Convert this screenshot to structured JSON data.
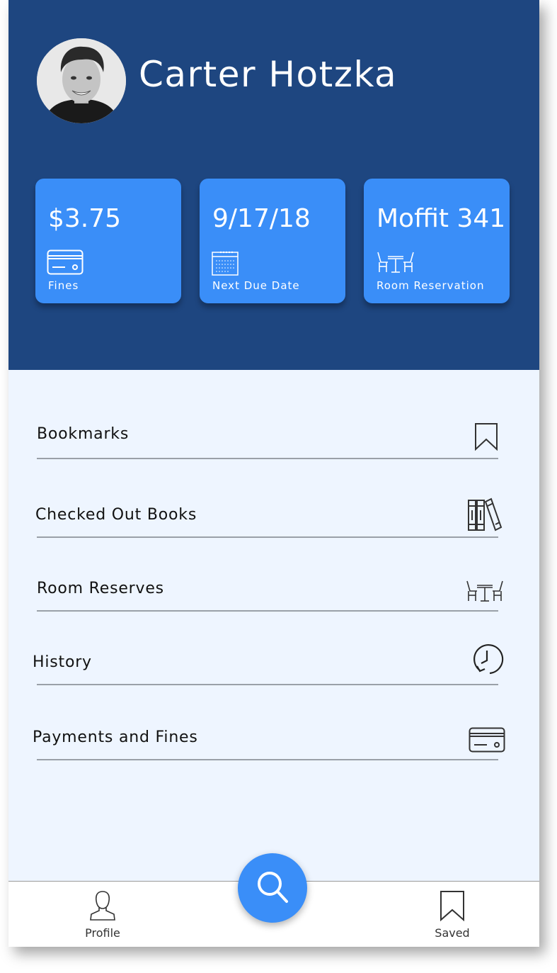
{
  "user": {
    "name": "Carter Hotzka"
  },
  "cards": [
    {
      "value": "$3.75",
      "label": "Fines",
      "icon": "credit-card-icon"
    },
    {
      "value": "9/17/18",
      "label": "Next Due Date",
      "icon": "calendar-icon"
    },
    {
      "value": "Moffit 341",
      "label": "Room Reservation",
      "icon": "table-chairs-icon"
    }
  ],
  "menu": [
    {
      "label": "Bookmarks",
      "icon": "bookmark-icon"
    },
    {
      "label": "Checked Out Books",
      "icon": "books-icon"
    },
    {
      "label": "Room Reserves",
      "icon": "table-chairs-icon"
    },
    {
      "label": "History",
      "icon": "history-clock-icon"
    },
    {
      "label": "Payments and Fines",
      "icon": "credit-card-icon"
    }
  ],
  "nav": {
    "profile_label": "Profile",
    "saved_label": "Saved",
    "search_icon": "search-icon"
  },
  "colors": {
    "header": "#1e4680",
    "card": "#3a8ef8",
    "background": "#eef5ff"
  }
}
